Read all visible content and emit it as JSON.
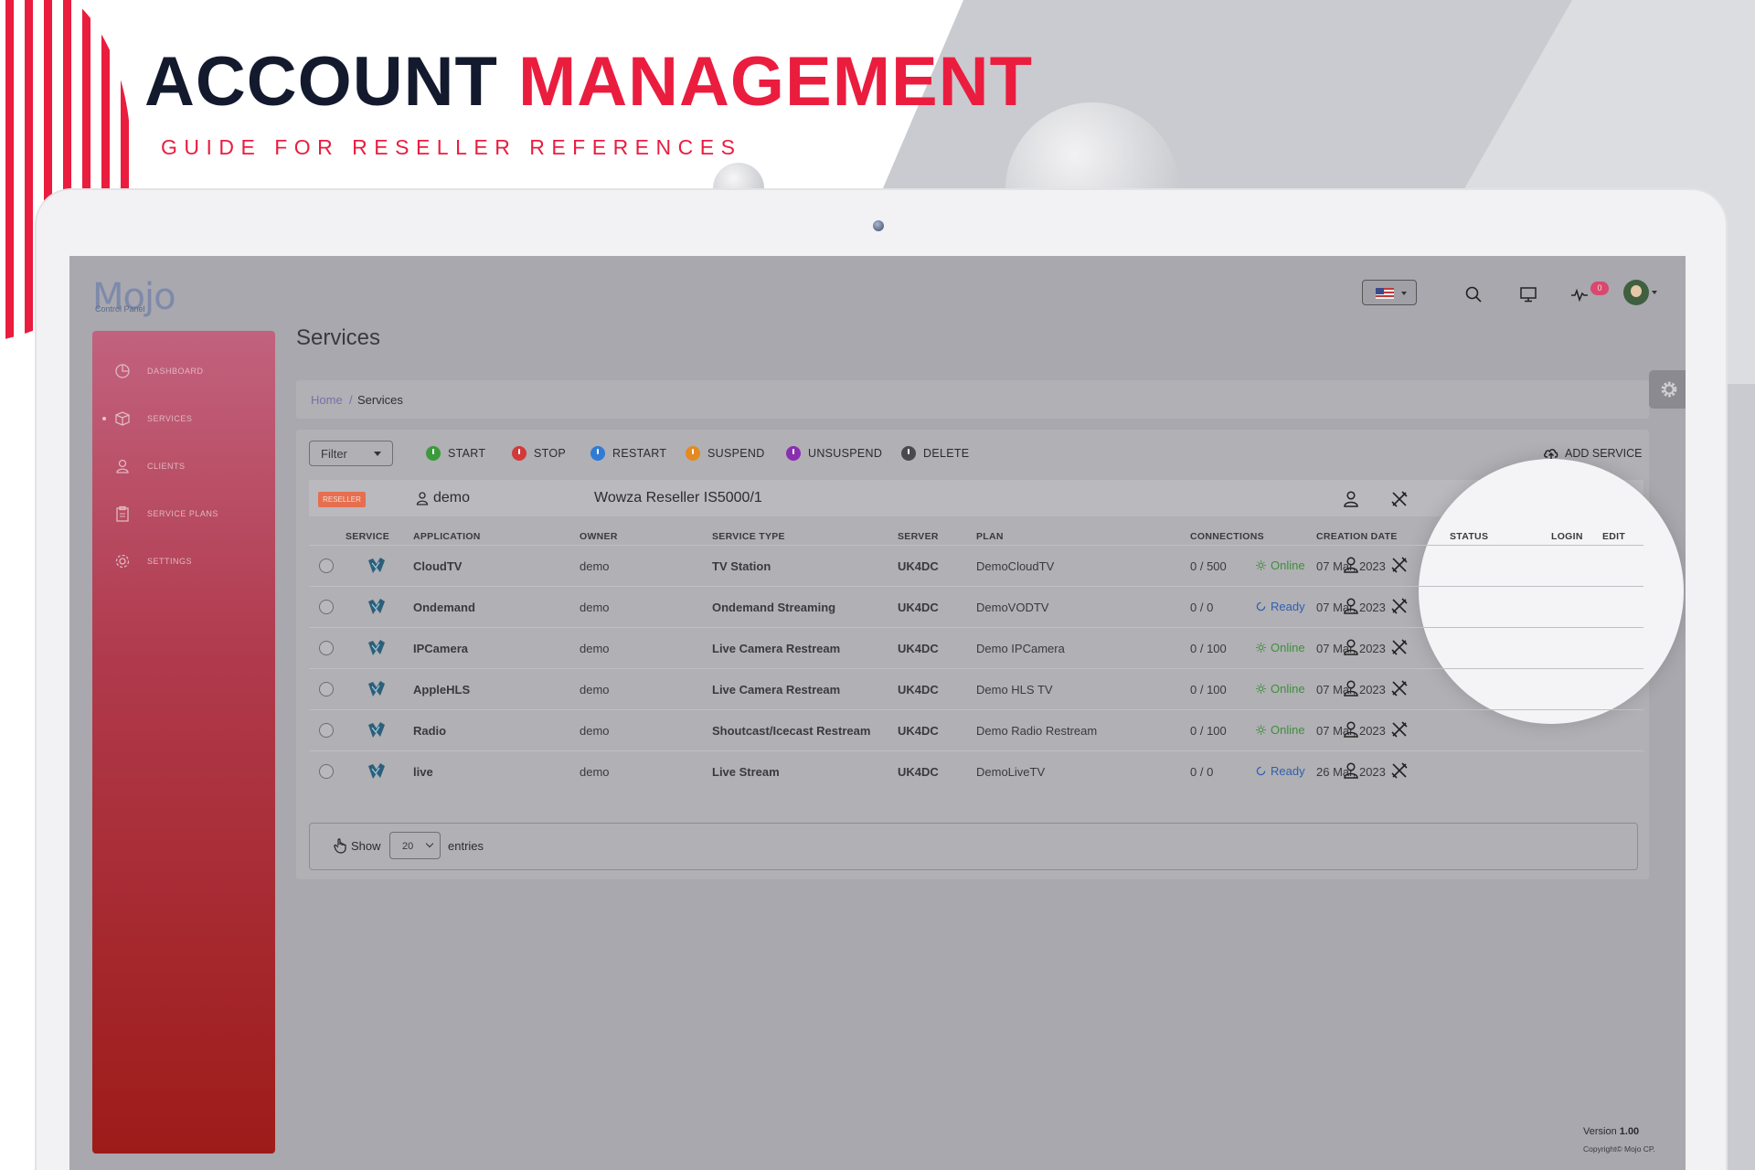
{
  "banner": {
    "title_part1": "ACCOUNT",
    "title_part2": "MANAGEMENT",
    "subtitle": "GUIDE FOR RESELLER REFERENCES"
  },
  "app": {
    "logo": "Mojo",
    "logo_sub": "Control Panel",
    "page_title": "Services",
    "version_label": "Version",
    "version": "1.00",
    "copyright": "Copyright© Mojo CP."
  },
  "sidebar": {
    "items": [
      {
        "label": "DASHBOARD",
        "icon": "pie-chart-icon"
      },
      {
        "label": "SERVICES",
        "icon": "box-icon"
      },
      {
        "label": "CLIENTS",
        "icon": "user-icon"
      },
      {
        "label": "SERVICE PLANS",
        "icon": "clipboard-icon"
      },
      {
        "label": "SETTINGS",
        "icon": "gear-icon"
      }
    ]
  },
  "topbar": {
    "language": "en-US",
    "notifications_count": "0"
  },
  "breadcrumb": {
    "home": "Home",
    "sep": "/",
    "current": "Services"
  },
  "toolbar": {
    "filter": "Filter",
    "start": "START",
    "stop": "STOP",
    "restart": "RESTART",
    "suspend": "SUSPEND",
    "unsuspend": "UNSUSPEND",
    "delete": "DELETE",
    "add_service": "ADD SERVICE",
    "colors": {
      "start": "#3c9a3c",
      "stop": "#d23a3a",
      "restart": "#2f7bd6",
      "suspend": "#e38a22",
      "unsuspend": "#8a2fb0",
      "delete": "#4a4a4e"
    }
  },
  "group": {
    "badge": "RESELLER",
    "user": "demo",
    "plan": "Wowza Reseller IS5000/1"
  },
  "table": {
    "headers": {
      "service": "SERVICE",
      "application": "APPLICATION",
      "owner": "OWNER",
      "service_type": "SERVICE TYPE",
      "server": "SERVER",
      "plan": "PLAN",
      "connections": "CONNECTIONS",
      "creation_date": "CREATION DATE",
      "status": "STATUS",
      "login": "LOGIN",
      "edit": "EDIT"
    },
    "rows": [
      {
        "application": "CloudTV",
        "owner": "demo",
        "service_type": "TV Station",
        "server": "UK4DC",
        "plan": "DemoCloudTV",
        "connections": "0 / 500",
        "creation_date": "07 Mar, 2023",
        "status": "Online"
      },
      {
        "application": "Ondemand",
        "owner": "demo",
        "service_type": "Ondemand Streaming",
        "server": "UK4DC",
        "plan": "DemoVODTV",
        "connections": "0 / 0",
        "creation_date": "07 Mar, 2023",
        "status": "Ready"
      },
      {
        "application": "IPCamera",
        "owner": "demo",
        "service_type": "Live Camera Restream",
        "server": "UK4DC",
        "plan": "Demo IPCamera",
        "connections": "0 / 100",
        "creation_date": "07 Mar, 2023",
        "status": "Online"
      },
      {
        "application": "AppleHLS",
        "owner": "demo",
        "service_type": "Live Camera Restream",
        "server": "UK4DC",
        "plan": "Demo HLS TV",
        "connections": "0 / 100",
        "creation_date": "07 Mar, 2023",
        "status": "Online"
      },
      {
        "application": "Radio",
        "owner": "demo",
        "service_type": "Shoutcast/Icecast Restream",
        "server": "UK4DC",
        "plan": "Demo Radio Restream",
        "connections": "0 / 100",
        "creation_date": "07 Mar, 2023",
        "status": "Online"
      },
      {
        "application": "live",
        "owner": "demo",
        "service_type": "Live Stream",
        "server": "UK4DC",
        "plan": "DemoLiveTV",
        "connections": "0 / 0",
        "creation_date": "26 Mar, 2023",
        "status": "Ready"
      }
    ]
  },
  "pagination": {
    "show": "Show",
    "entries_value": "20",
    "entries": "entries"
  }
}
